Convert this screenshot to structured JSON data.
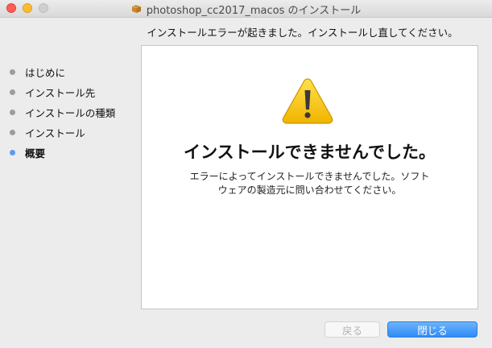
{
  "window": {
    "title": "photoshop_cc2017_macos のインストール",
    "controls": {
      "close_color": "#fc5f57",
      "minimize_color": "#fdbc2e",
      "zoom_color": "#d0d0d0"
    },
    "title_icon": "package-icon"
  },
  "subtitle": "インストールエラーが起きました。インストールし直してください。",
  "sidebar": {
    "steps": [
      {
        "label": "はじめに",
        "active": false
      },
      {
        "label": "インストール先",
        "active": false
      },
      {
        "label": "インストールの種類",
        "active": false
      },
      {
        "label": "インストール",
        "active": false
      },
      {
        "label": "概要",
        "active": true
      }
    ],
    "active_color": "#5a9bf5"
  },
  "content": {
    "icon": "warning-icon",
    "headline": "インストールできませんでした。",
    "message_line1": "エラーによってインストールできませんでした。ソフト",
    "message_line2": "ウェアの製造元に問い合わせてください。"
  },
  "buttons": {
    "back_label": "戻る",
    "close_label": "閉じる",
    "accent_color": "#2f8cf6"
  }
}
